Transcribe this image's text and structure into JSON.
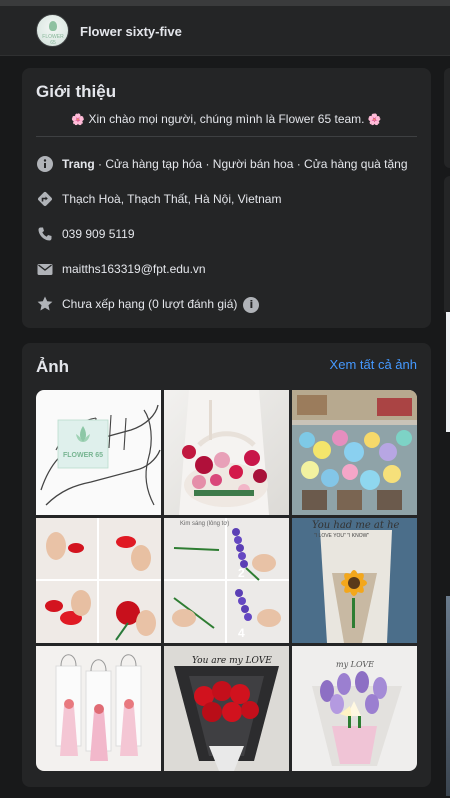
{
  "header": {
    "page_name": "Flower sixty-five",
    "avatar_text": "FLOWER 65"
  },
  "intro": {
    "title": "Giới thiệu",
    "greeting": "Xin chào mọi người, chúng mình là Flower 65 team.",
    "greeting_emoji": "🌸",
    "category_prefix": "Trang",
    "categories": " · Cửa hàng tạp hóa · Người bán hoa · Cửa hàng quà tặng",
    "address": "Thạch Hoà, Thạch Thất, Hà Nội, Vietnam",
    "phone": "039 909 5119",
    "email": "maitths163319@fpt.edu.vn",
    "rating": "Chưa xếp hạng (0 lượt đánh giá)",
    "icons": [
      "info-icon",
      "directions-icon",
      "phone-icon",
      "mail-icon",
      "star-icon",
      "info-small-icon"
    ]
  },
  "photos": {
    "title": "Ảnh",
    "see_all": "Xem tất cả ảnh",
    "items": [
      {
        "label": "FLOWER 65"
      },
      {
        "label": ""
      },
      {
        "label": ""
      },
      {
        "label": ""
      },
      {
        "label": "Kim sáng (lông tơ)",
        "badge_a": "2",
        "badge_b": "4"
      },
      {
        "label": "You had me at he",
        "sub": "\"I LOVE YOU\"  \"I KNOW\""
      },
      {
        "label": ""
      },
      {
        "label": "You are my LOVE"
      },
      {
        "label": "my LOVE"
      }
    ]
  },
  "colors": {
    "background": "#18191a",
    "card": "#242526",
    "link": "#4599ff",
    "text": "#e4e6eb"
  }
}
